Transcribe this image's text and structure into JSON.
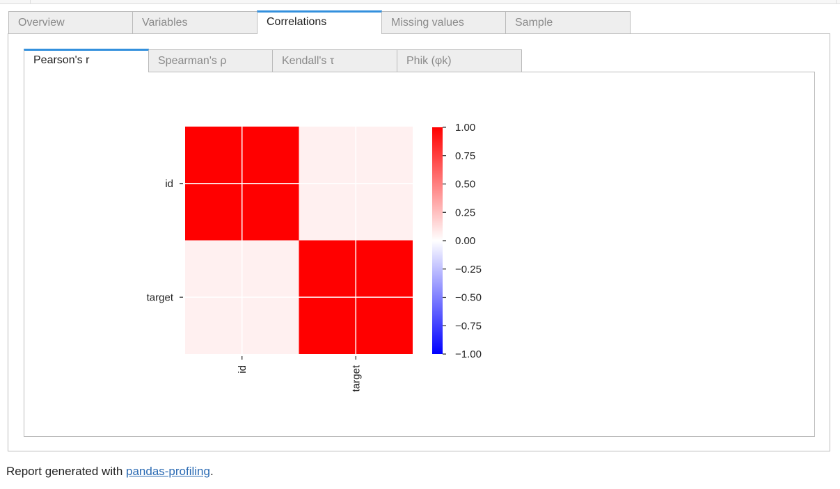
{
  "tabs": [
    {
      "label": "Overview"
    },
    {
      "label": "Variables"
    },
    {
      "label": "Correlations"
    },
    {
      "label": "Missing values"
    },
    {
      "label": "Sample"
    }
  ],
  "active_tab": "Correlations",
  "subtabs": [
    {
      "label": "Pearson's r"
    },
    {
      "label": "Spearman's ρ"
    },
    {
      "label": "Kendall's τ"
    },
    {
      "label": "Phik (φk)"
    }
  ],
  "active_subtab": "Pearson's r",
  "chart_data": {
    "type": "heatmap",
    "title": "",
    "x_labels": [
      "id",
      "target"
    ],
    "y_labels": [
      "id",
      "target"
    ],
    "matrix": [
      [
        1.0,
        0.06
      ],
      [
        0.06,
        1.0
      ]
    ],
    "colorbar": {
      "range": [
        -1.0,
        1.0
      ],
      "ticks": [
        "1.00",
        "0.75",
        "0.50",
        "0.25",
        "0.00",
        "−0.25",
        "−0.50",
        "−0.75",
        "−1.00"
      ],
      "colors": {
        "low": "#0000ff",
        "mid": "#ffffff",
        "high": "#ff0000"
      }
    },
    "grid": true
  },
  "footer": {
    "prefix": "Report generated with ",
    "link_text": "pandas-profiling",
    "suffix": "."
  }
}
